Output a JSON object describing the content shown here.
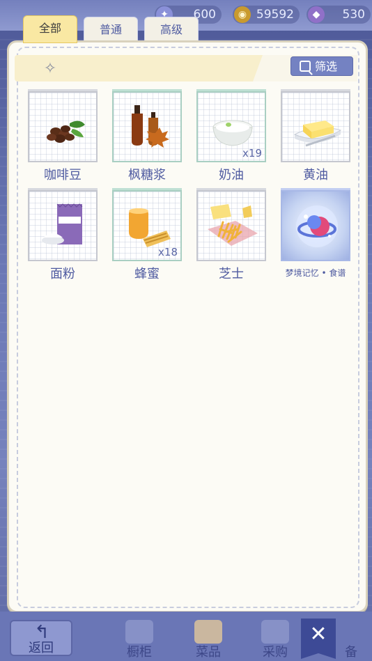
{
  "currencies": [
    {
      "icon": "dream-crystal-icon",
      "value": "600"
    },
    {
      "icon": "gold-coin-icon",
      "value": "59592"
    },
    {
      "icon": "diamond-plus-icon",
      "value": "530"
    }
  ],
  "tabs": [
    {
      "label": "全部",
      "active": true
    },
    {
      "label": "普通",
      "active": false
    },
    {
      "label": "高级",
      "active": false
    }
  ],
  "filter_label": "筛选",
  "items": [
    {
      "name": "咖啡豆",
      "qty": "",
      "icon": "coffee-beans-icon"
    },
    {
      "name": "枫糖浆",
      "qty": "",
      "icon": "maple-syrup-icon"
    },
    {
      "name": "奶油",
      "qty": "x19",
      "icon": "cream-bowl-icon"
    },
    {
      "name": "黄油",
      "qty": "",
      "icon": "butter-icon"
    },
    {
      "name": "面粉",
      "qty": "",
      "icon": "flour-bag-icon"
    },
    {
      "name": "蜂蜜",
      "qty": "x18",
      "icon": "honey-jar-icon"
    },
    {
      "name": "芝士",
      "qty": "",
      "icon": "cheese-icon"
    },
    {
      "name": "梦境记忆 • 食谱",
      "qty": "",
      "icon": "dream-memory-recipe-icon"
    }
  ],
  "bottom_nav": {
    "back": "返回",
    "items": [
      "橱柜",
      "菜品",
      "采购",
      "备"
    ]
  },
  "close_glyph": "✕"
}
